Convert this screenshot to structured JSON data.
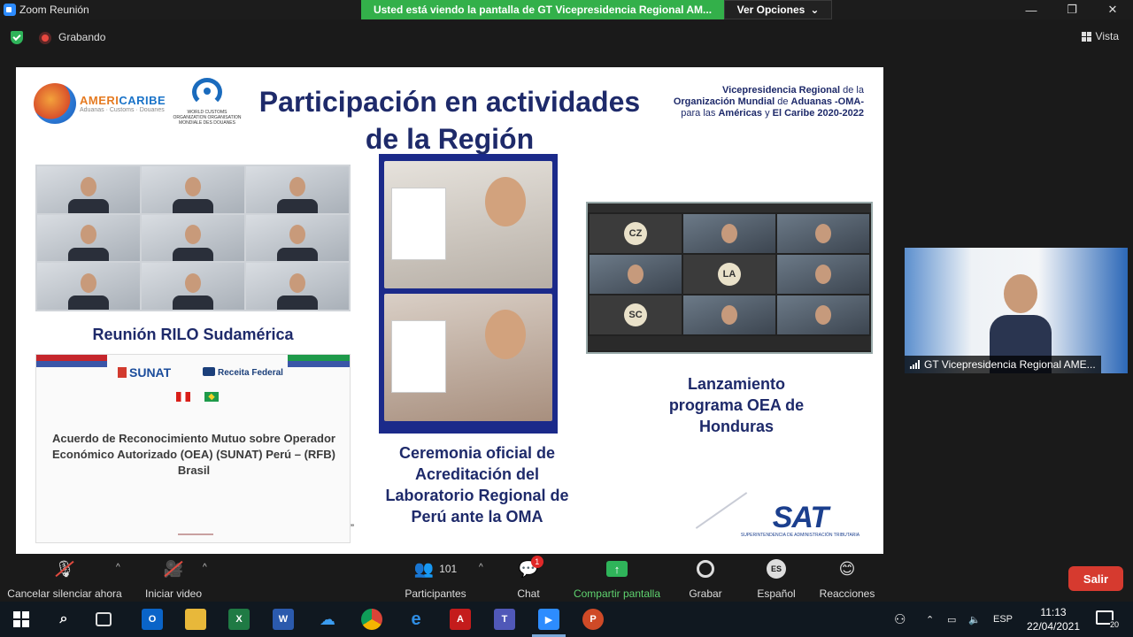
{
  "window": {
    "title": "Zoom Reunión",
    "minimize": "—",
    "maximize": "❐",
    "close": "✕"
  },
  "share_banner": "Usted está viendo la pantalla de GT Vicepresidencia Regional AM...",
  "view_options": {
    "label": "Ver Opciones",
    "chevron": "⌄"
  },
  "status": {
    "recording": "Grabando",
    "view_label": "Vista"
  },
  "slide": {
    "ac_logo": {
      "part1": "AMERI",
      "part2": "CARIBE",
      "sub": "Aduanas · Customs · Douanes"
    },
    "wco_logo": "WORLD CUSTOMS ORGANIZATION ORGANISATION MONDIALE DES DOUANES",
    "title": "Participación en actividades de la Región",
    "vp_text": {
      "part1": "Vicepresidencia Regional",
      "part2": " de la ",
      "part3": "Organización Mundial",
      "part4": " de ",
      "part5": "Aduanas -OMA-",
      "part6": "para las ",
      "part7": "Américas",
      "part8": " y ",
      "part9": "El Caribe 2020-2022"
    },
    "rilo_caption": "Reunión RILO Sudamérica",
    "acuerdo": {
      "sunat": "SUNAT",
      "receita": "Receita Federal",
      "text": "Acuerdo de Reconocimiento Mutuo sobre Operador Económico Autorizado (OEA) (SUNAT) Perú – (RFB) Brasil"
    },
    "ceremonia_caption": "Ceremonia oficial de Acreditación del Laboratorio Regional de Perú ante la OMA",
    "oea": {
      "caption": "Lanzamiento programa OEA de Honduras",
      "avatars": [
        "CZ",
        "LA",
        "SC"
      ]
    },
    "sat": {
      "mark": "SAT",
      "sub": "SUPERINTENDENCIA DE ADMINISTRACIÓN TRIBUTARIA"
    },
    "quote_mark": "”"
  },
  "participant": {
    "name": "GT Vicepresidencia Regional AME..."
  },
  "toolbar": {
    "mute": "Cancelar silenciar ahora",
    "video": "Iniciar video",
    "participants": "Participantes",
    "participants_count": "101",
    "chat": "Chat",
    "chat_badge": "1",
    "share": "Compartir pantalla",
    "record": "Grabar",
    "language": "Español",
    "language_code": "ES",
    "reactions": "Reacciones",
    "leave": "Salir",
    "caret": "^"
  },
  "taskbar": {
    "lang": "ESP",
    "time": "11:13",
    "date": "22/04/2021",
    "notifications": "20"
  }
}
